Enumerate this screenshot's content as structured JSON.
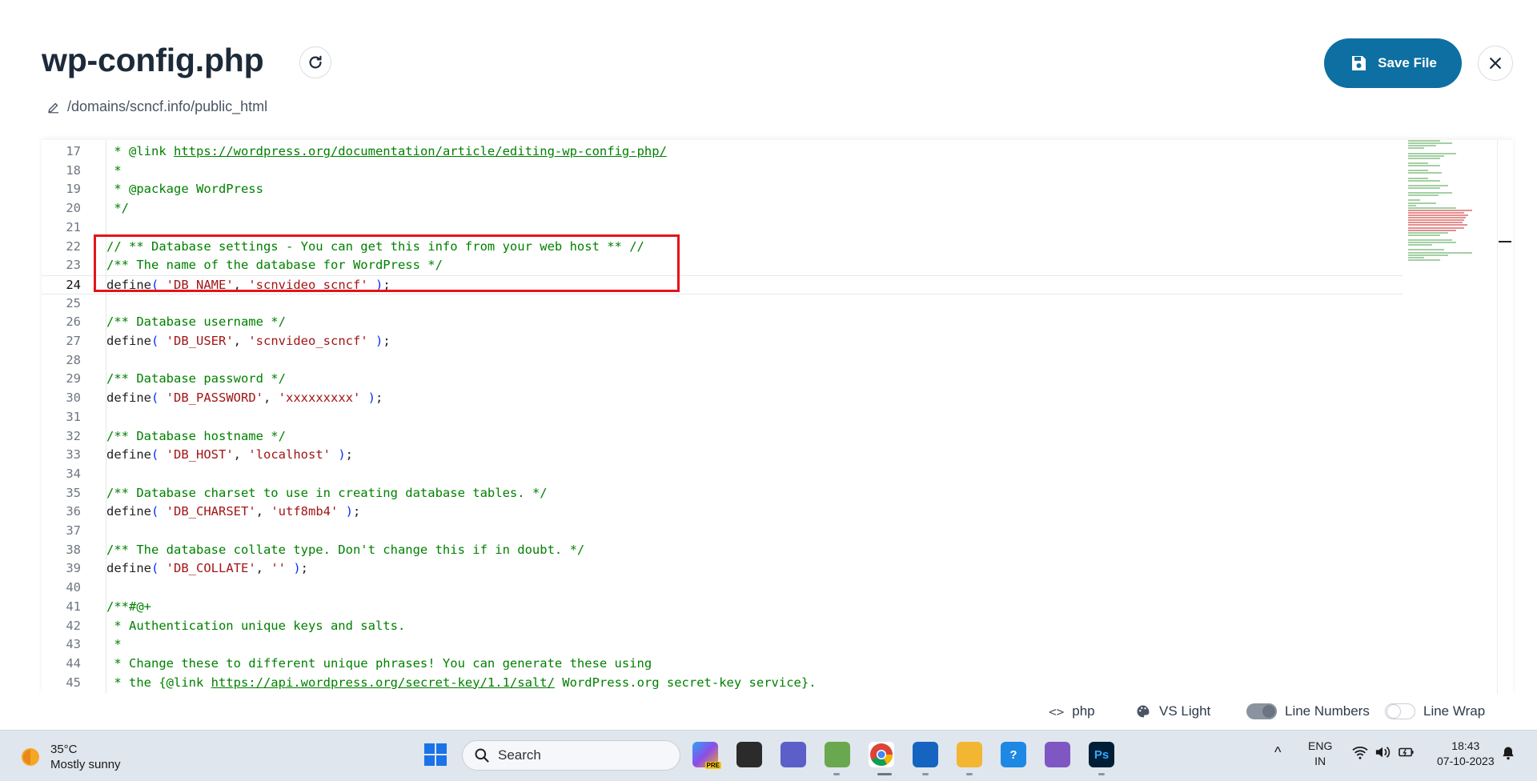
{
  "header": {
    "filename": "wp-config.php",
    "path": "/domains/scncf.info/public_html",
    "save_label": "Save File"
  },
  "editor": {
    "lines": [
      {
        "n": "17",
        "parts": [
          [
            "c",
            " * @link "
          ],
          [
            "cu",
            "https://wordpress.org/documentation/article/editing-wp-config-php/"
          ]
        ]
      },
      {
        "n": "18",
        "parts": [
          [
            "c",
            " *"
          ]
        ]
      },
      {
        "n": "19",
        "parts": [
          [
            "c",
            " * @package WordPress"
          ]
        ]
      },
      {
        "n": "20",
        "parts": [
          [
            "c",
            " */"
          ]
        ]
      },
      {
        "n": "21",
        "parts": []
      },
      {
        "n": "22",
        "parts": [
          [
            "c",
            "// ** Database settings - You can get this info from your web host ** //"
          ]
        ]
      },
      {
        "n": "23",
        "parts": [
          [
            "c",
            "/** The name of the database for WordPress */"
          ]
        ]
      },
      {
        "n": "24",
        "parts": [
          [
            "f",
            "define"
          ],
          [
            "p",
            "( "
          ],
          [
            "s",
            "'DB_NAME'"
          ],
          [
            "f",
            ", "
          ],
          [
            "s",
            "'scnvideo_scncf'"
          ],
          [
            "p",
            " )"
          ],
          [
            "f",
            ";"
          ]
        ]
      },
      {
        "n": "25",
        "parts": []
      },
      {
        "n": "26",
        "parts": [
          [
            "c",
            "/** Database username */"
          ]
        ]
      },
      {
        "n": "27",
        "parts": [
          [
            "f",
            "define"
          ],
          [
            "p",
            "( "
          ],
          [
            "s",
            "'DB_USER'"
          ],
          [
            "f",
            ", "
          ],
          [
            "s",
            "'scnvideo_scncf'"
          ],
          [
            "p",
            " )"
          ],
          [
            "f",
            ";"
          ]
        ]
      },
      {
        "n": "28",
        "parts": []
      },
      {
        "n": "29",
        "parts": [
          [
            "c",
            "/** Database password */"
          ]
        ]
      },
      {
        "n": "30",
        "parts": [
          [
            "f",
            "define"
          ],
          [
            "p",
            "( "
          ],
          [
            "s",
            "'DB_PASSWORD'"
          ],
          [
            "f",
            ", "
          ],
          [
            "s",
            "'xxxxxxxxx'"
          ],
          [
            "p",
            " )"
          ],
          [
            "f",
            ";"
          ]
        ]
      },
      {
        "n": "31",
        "parts": []
      },
      {
        "n": "32",
        "parts": [
          [
            "c",
            "/** Database hostname */"
          ]
        ]
      },
      {
        "n": "33",
        "parts": [
          [
            "f",
            "define"
          ],
          [
            "p",
            "( "
          ],
          [
            "s",
            "'DB_HOST'"
          ],
          [
            "f",
            ", "
          ],
          [
            "s",
            "'localhost'"
          ],
          [
            "p",
            " )"
          ],
          [
            "f",
            ";"
          ]
        ]
      },
      {
        "n": "34",
        "parts": []
      },
      {
        "n": "35",
        "parts": [
          [
            "c",
            "/** Database charset to use in creating database tables. */"
          ]
        ]
      },
      {
        "n": "36",
        "parts": [
          [
            "f",
            "define"
          ],
          [
            "p",
            "( "
          ],
          [
            "s",
            "'DB_CHARSET'"
          ],
          [
            "f",
            ", "
          ],
          [
            "s",
            "'utf8mb4'"
          ],
          [
            "p",
            " )"
          ],
          [
            "f",
            ";"
          ]
        ]
      },
      {
        "n": "37",
        "parts": []
      },
      {
        "n": "38",
        "parts": [
          [
            "c",
            "/** The database collate type. Don't change this if in doubt. */"
          ]
        ]
      },
      {
        "n": "39",
        "parts": [
          [
            "f",
            "define"
          ],
          [
            "p",
            "( "
          ],
          [
            "s",
            "'DB_COLLATE'"
          ],
          [
            "f",
            ", "
          ],
          [
            "s",
            "''"
          ],
          [
            "p",
            " )"
          ],
          [
            "f",
            ";"
          ]
        ]
      },
      {
        "n": "40",
        "parts": []
      },
      {
        "n": "41",
        "parts": [
          [
            "c",
            "/**#@+"
          ]
        ]
      },
      {
        "n": "42",
        "parts": [
          [
            "c",
            " * Authentication unique keys and salts."
          ]
        ]
      },
      {
        "n": "43",
        "parts": [
          [
            "c",
            " *"
          ]
        ]
      },
      {
        "n": "44",
        "parts": [
          [
            "c",
            " * Change these to different unique phrases! You can generate these using"
          ]
        ]
      },
      {
        "n": "45",
        "parts": [
          [
            "c",
            " * the {@link "
          ],
          [
            "cu",
            "https://api.wordpress.org/secret-key/1.1/salt/"
          ],
          [
            "c",
            " WordPress.org secret-key service}."
          ]
        ]
      }
    ],
    "active_line": "24",
    "colors": {
      "comment": "#008000",
      "string": "#a31515",
      "paren": "#0431fa",
      "highlight_box": "#e3141b"
    }
  },
  "statusbar": {
    "language": "php",
    "theme": "VS Light",
    "line_numbers_label": "Line Numbers",
    "line_numbers_on": true,
    "line_wrap_label": "Line Wrap",
    "line_wrap_on": false
  },
  "taskbar": {
    "weather_temp": "35°C",
    "weather_desc": "Mostly sunny",
    "search_placeholder": "Search",
    "lang_1": "ENG",
    "lang_2": "IN",
    "time": "18:43",
    "date": "07-10-2023",
    "copilot_badge": "PRE",
    "ps_label": "Ps"
  }
}
